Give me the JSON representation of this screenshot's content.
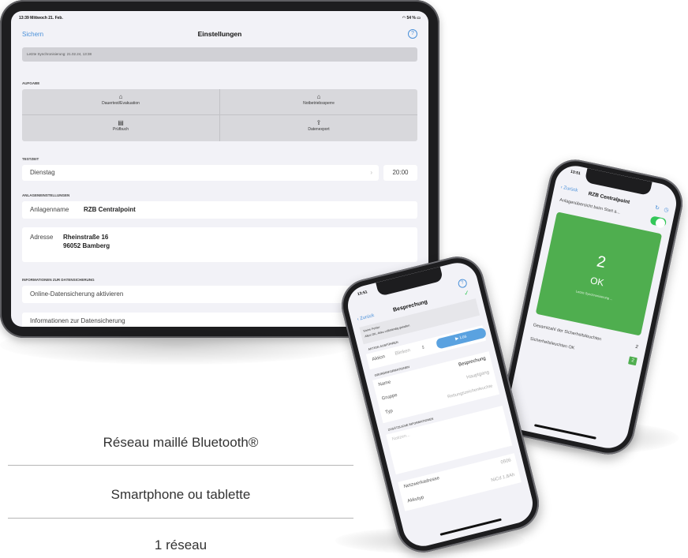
{
  "tablet": {
    "status": {
      "time_date": "13:39  Mittwoch 21. Feb.",
      "battery": "54 %"
    },
    "nav": {
      "back": "Sichern",
      "title": "Einstellungen",
      "help": "?"
    },
    "sync": "Letzte Synchronisierung: 21.02.24, 13:38",
    "sections": {
      "aufgabe": "AUFGABE",
      "testzeit": "TESTZEIT",
      "anlage": "ANLAGENEINSTELLUNGEN",
      "info": "INFORMATIONEN ZUR DATENSICHERUNG"
    },
    "tasks": [
      {
        "label": "Dauertest/Evakuation",
        "icon": "home-icon"
      },
      {
        "label": "Notbetriebssperre",
        "icon": "house-outline-icon"
      },
      {
        "label": "Prüfbuch",
        "icon": "book-icon"
      },
      {
        "label": "Datenexport",
        "icon": "export-icon"
      }
    ],
    "testzeit": {
      "day": "Dienstag",
      "time": "20:00"
    },
    "anlage": {
      "name_label": "Anlagenname",
      "name_value": "RZB Centralpoint",
      "addr_label": "Adresse",
      "addr_line1": "Rheinstraße 16",
      "addr_line2": "96052 Bamberg"
    },
    "info_rows": {
      "online": "Online-Datensicherung aktivieren",
      "details": "Informationen zur Datensicherung"
    }
  },
  "phone_right": {
    "time": "13:51",
    "back": "Zurück",
    "title": "RZB Centralpoint",
    "overview_label": "Anlagenübersicht beim Start a...",
    "count": "2",
    "status": "OK",
    "sync_note": "Letzte Synchronisierung ...",
    "total_label": "Gesamtzahl der Sicherheitsleuchten",
    "total_value": "2",
    "ok_label": "Sicherheitsleuchten OK",
    "ok_value": "2"
  },
  "phone_left": {
    "time": "13:51",
    "back": "Zurück",
    "title": "Besprechung",
    "help": "?",
    "status_line1": "Keine Fehler",
    "status_line2": "Alles OK, Akku vollständig geladen",
    "sec_action": "AKTION AUSFÜHREN",
    "action_label": "Aktion",
    "action_value": "Blinken",
    "los": "Los",
    "sec_basic": "GRUNDINFORMATIONEN",
    "name_label": "Name",
    "name_value": "Besprechung",
    "group_label": "Gruppe",
    "group_value": "Hauptgang",
    "type_label": "Typ",
    "type_value": "Rettungszeichenleuchte",
    "sec_extra": "ZUSÄTZLICHE INFORMATIONEN",
    "notes_placeholder": "Notizen...",
    "net_label": "Netzwerkadresse",
    "net_value": "0506",
    "batt_label": "Akkutyp",
    "batt_value": "NiCd 1.8Ah"
  },
  "features": [
    "Réseau maillé Bluetooth®",
    "Smartphone ou tablette",
    "1 réseau"
  ],
  "colors": {
    "accent": "#4a90d9",
    "toggle": "#34c759",
    "ok_green": "#4fae4f"
  }
}
